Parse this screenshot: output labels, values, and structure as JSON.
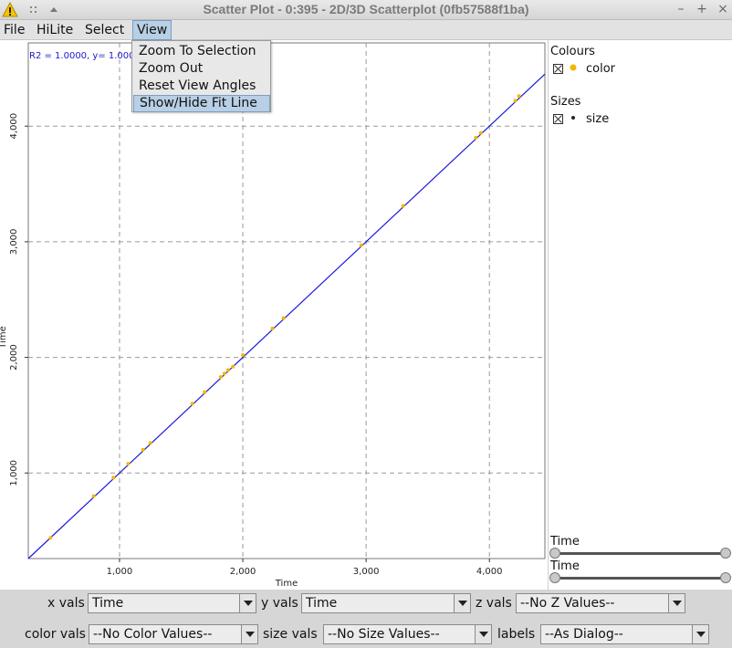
{
  "window": {
    "title": "Scatter Plot - 0:395 - 2D/3D Scatterplot (0fb57588f1ba)",
    "controls": [
      "–",
      "+",
      "×"
    ]
  },
  "menubar": {
    "items": [
      "File",
      "HiLite",
      "Select",
      "View"
    ]
  },
  "view_menu": {
    "items": [
      "Zoom To Selection",
      "Zoom Out",
      "Reset View Angles",
      "Show/Hide Fit Line"
    ],
    "highlighted": "Show/Hide Fit Line"
  },
  "plot": {
    "fit_label": "R2 = 1.0000, y= 1.000",
    "fit_line_color": "#1a1adb",
    "point_color": "#f2b705"
  },
  "chart_data": {
    "type": "scatter",
    "xlabel": "Time",
    "ylabel": "Time",
    "xlim": [
      260,
      4450
    ],
    "ylim": [
      260,
      4720
    ],
    "xticks": [
      1000,
      2000,
      3000,
      4000
    ],
    "yticks": [
      1000,
      2000,
      3000,
      4000
    ],
    "xtick_labels": [
      "1,000",
      "2,000",
      "3,000",
      "4,000"
    ],
    "ytick_labels": [
      "1,000",
      "2,000",
      "3,000",
      "4,000"
    ],
    "grid": true,
    "fit_line": {
      "slope": 1.0,
      "intercept": 0.0
    },
    "x": [
      440,
      790,
      950,
      1070,
      1190,
      1250,
      1590,
      1690,
      1820,
      1850,
      1880,
      1920,
      2000,
      2240,
      2330,
      2960,
      3300,
      3890,
      3930,
      4210,
      4240
    ],
    "y": [
      440,
      800,
      960,
      1080,
      1200,
      1260,
      1600,
      1700,
      1830,
      1860,
      1890,
      1920,
      2020,
      2250,
      2340,
      2970,
      3310,
      3900,
      3940,
      4220,
      4260
    ]
  },
  "right_panel": {
    "colours_title": "Colours",
    "colour_entry": "color",
    "sizes_title": "Sizes",
    "size_entry": "size",
    "slider1_label": "Time",
    "slider2_label": "Time"
  },
  "controls": {
    "x_vals_label": "x vals",
    "x_vals_value": "Time",
    "y_vals_label": "y vals",
    "y_vals_value": "Time",
    "z_vals_label": "z vals",
    "z_vals_value": "--No Z Values--",
    "color_vals_label": "color vals",
    "color_vals_value": "--No Color Values--",
    "size_vals_label": "size vals",
    "size_vals_value": "--No Size Values--",
    "labels_label": "labels",
    "labels_value": "--As Dialog--"
  }
}
